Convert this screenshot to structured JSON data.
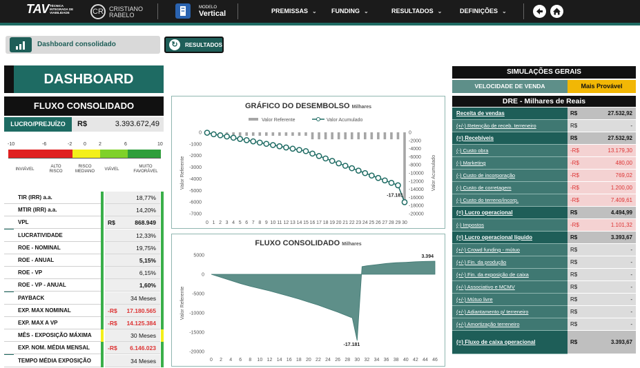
{
  "topbar": {
    "brand_tav": "TAV",
    "brand_tav_sub": "TÉCNICA INTEGRADA DE VIABILIDADE",
    "brand_cr_line1": "CRISTIANO",
    "brand_cr_line2": "RABELO",
    "modelo_label": "MODELO",
    "modelo_value": "Vertical",
    "menu": [
      "PREMISSAS",
      "FUNDING",
      "RESULTADOS",
      "DEFINIÇÕES"
    ],
    "icons": [
      "back-arrow-icon",
      "home-icon"
    ]
  },
  "breadcrumb": {
    "label": "Dashboard consolidado"
  },
  "resultados_button": "RESULTADOS",
  "dashboard_title": "DASHBOARD",
  "fluxo_title": "FLUXO CONSOLIDADO",
  "lucro": {
    "label": "LUCRO/PREJUÍZO",
    "currency": "R$",
    "value": "3.393.672,49"
  },
  "scale": {
    "numbers": [
      "-10",
      "-6",
      "-2",
      "0",
      "2",
      "6",
      "10"
    ],
    "labels": [
      "INVIÁVEL",
      "ALTO RISCO",
      "RISCO MEDIANO",
      "VIÁVEL",
      "MUITO FAVORÁVEL"
    ],
    "colors": [
      "#e02020",
      "#f3ef1a",
      "#7fd12a",
      "#2f9e3b"
    ]
  },
  "kpis": [
    {
      "label": "TIR (IRR) a.a.",
      "currency": "",
      "value": "18,77%",
      "bold": false,
      "red": false
    },
    {
      "label": "MTIR (IRR) a.a.",
      "currency": "",
      "value": "14,20%",
      "bold": false,
      "red": false
    },
    {
      "label": "VPL",
      "currency": "R$",
      "value": "868.949",
      "bold": true,
      "red": false
    },
    {
      "label": "LUCRATIVIDADE",
      "currency": "",
      "value": "12,33%",
      "bold": false,
      "red": false
    },
    {
      "label": "ROE - NOMINAL",
      "currency": "",
      "value": "19,75%",
      "bold": false,
      "red": false
    },
    {
      "label": "ROE - ANUAL",
      "currency": "",
      "value": "5,15%",
      "bold": true,
      "red": false
    },
    {
      "label": "ROE - VP",
      "currency": "",
      "value": "6,15%",
      "bold": false,
      "red": false
    },
    {
      "label": "ROE - VP - ANUAL",
      "currency": "",
      "value": "1,60%",
      "bold": true,
      "red": false
    },
    {
      "label": "PAYBACK",
      "currency": "",
      "value": "34 Meses",
      "bold": false,
      "red": false
    },
    {
      "label": "EXP. MAX NOMINAL",
      "currency": "-R$",
      "value": "17.180.565",
      "bold": true,
      "red": true
    },
    {
      "label": "EXP. MAX A VP",
      "currency": "-R$",
      "value": "14.125.384",
      "bold": true,
      "red": true
    },
    {
      "label": "MÊS - EXPOSIÇÃO MÁXIMA",
      "currency": "",
      "value": "30 Meses",
      "bold": false,
      "red": false
    },
    {
      "label": "EXP. NOM. MÉDIA MENSAL",
      "currency": "-R$",
      "value": "6.146.023",
      "bold": true,
      "red": true
    },
    {
      "label": "TEMPO MÉDIA EXPOSIÇÃO",
      "currency": "",
      "value": "34 Meses",
      "bold": false,
      "red": false
    }
  ],
  "chart_data": [
    {
      "type": "bar",
      "title": "GRÁFICO DO DESEMBOLSO",
      "subtitle": "Milhares",
      "legend": [
        "Valor Referente",
        "Valor Acumulado"
      ],
      "legend_position": "top",
      "ylabel": "Valor Referente",
      "y2label": "Valor Acumulado",
      "ylim": [
        -7000,
        0
      ],
      "y2lim": [
        -20000,
        0
      ],
      "yticks": [
        "-7000",
        "-6000",
        "-5000",
        "-4000",
        "-3000",
        "-2000",
        "-1000",
        "0"
      ],
      "y2ticks": [
        "-20000",
        "-18000",
        "-16000",
        "-14000",
        "-12000",
        "-10000",
        "-8000",
        "-6000",
        "-4000",
        "-2000",
        "0"
      ],
      "categories": [
        "0",
        "1",
        "2",
        "3",
        "4",
        "5",
        "6",
        "7",
        "8",
        "9",
        "10",
        "11",
        "12",
        "13",
        "14",
        "15",
        "16",
        "17",
        "18",
        "19",
        "20",
        "21",
        "22",
        "23",
        "24",
        "25",
        "26",
        "27",
        "28",
        "29",
        "30"
      ],
      "series": [
        {
          "name": "Valor Referente",
          "type": "bar",
          "color": "#a6a6a6",
          "values": [
            -100,
            -380,
            -250,
            -300,
            -300,
            -300,
            -300,
            -300,
            -300,
            -300,
            -300,
            -300,
            -300,
            -300,
            -300,
            -300,
            -600,
            -600,
            -600,
            -600,
            -600,
            -600,
            -600,
            -600,
            -600,
            -600,
            -600,
            -600,
            -600,
            -600,
            -6000
          ]
        },
        {
          "name": "Valor Acumulado",
          "type": "line",
          "color": "#1e6b63",
          "values": [
            -100,
            -480,
            -730,
            -1030,
            -1330,
            -1630,
            -1930,
            -2230,
            -2530,
            -2830,
            -3130,
            -3430,
            -3730,
            -4030,
            -4330,
            -4630,
            -5230,
            -5830,
            -6430,
            -7030,
            -7630,
            -8230,
            -8830,
            -9430,
            -10030,
            -10630,
            -11230,
            -11830,
            -12430,
            -13030,
            -17181
          ]
        }
      ],
      "annotations": [
        {
          "label": "-17.181",
          "x": "30"
        }
      ]
    },
    {
      "type": "area",
      "title": "FLUXO CONSOLIDADO",
      "subtitle": "Milhares",
      "ylabel": "Valor Referente",
      "ylim": [
        -20000,
        5000
      ],
      "yticks": [
        "-20000",
        "-15000",
        "-10000",
        "-5000",
        "0",
        "5000"
      ],
      "xticks": [
        "0",
        "2",
        "4",
        "6",
        "8",
        "10",
        "12",
        "14",
        "16",
        "18",
        "20",
        "22",
        "24",
        "26",
        "28",
        "30",
        "32",
        "34",
        "36",
        "38",
        "40",
        "42",
        "44",
        "46"
      ],
      "series": [
        {
          "name": "Fluxo",
          "color": "#5e8f89",
          "x": [
            0,
            2,
            4,
            6,
            8,
            10,
            12,
            14,
            16,
            18,
            20,
            22,
            24,
            26,
            28,
            29,
            30,
            31,
            32,
            34,
            36,
            38,
            40,
            42,
            44,
            46
          ],
          "values": [
            0,
            -800,
            -1600,
            -2400,
            -3100,
            -3700,
            -4300,
            -5000,
            -5700,
            -6400,
            -7200,
            -8000,
            -8900,
            -9800,
            -10800,
            -11300,
            -17181,
            2000,
            2200,
            2500,
            2800,
            3000,
            3100,
            3250,
            3350,
            3394
          ]
        }
      ],
      "annotations": [
        {
          "label": "3.394",
          "x": 46
        },
        {
          "label": "-17.181",
          "x": 30
        }
      ]
    }
  ],
  "simulacoes": {
    "title": "SIMULAÇÕES GERAIS",
    "vv_label": "VELOCIDADE DE VENDA",
    "vv_value": "Mais Provável"
  },
  "dre": {
    "title": "DRE - Milhares de Reais",
    "rows": [
      {
        "label": "Receita de vendas",
        "currency": "R$",
        "value": "27.532,92",
        "style": "hd"
      },
      {
        "label": "(+/-) Retenção de receb. terreneiro",
        "currency": "R$",
        "value": "-",
        "style": ""
      },
      {
        "label": "(=) Recebíveis",
        "currency": "R$",
        "value": "27.532,92",
        "style": "hd"
      },
      {
        "label": "(-) Custo obra",
        "currency": "-R$",
        "value": "13.179,30",
        "style": "neg"
      },
      {
        "label": "(-) Marketing",
        "currency": "-R$",
        "value": "480,00",
        "style": "neg"
      },
      {
        "label": "(-) Custo de incorporação",
        "currency": "-R$",
        "value": "769,02",
        "style": "neg"
      },
      {
        "label": "(-) Custo de corretagem",
        "currency": "-R$",
        "value": "1.200,00",
        "style": "neg"
      },
      {
        "label": "(-) Custo do terreno/incorp.",
        "currency": "-R$",
        "value": "7.409,61",
        "style": "neg"
      },
      {
        "label": "(=) Lucro operacional",
        "currency": "R$",
        "value": "4.494,99",
        "style": "hd"
      },
      {
        "label": "(-) Impostos",
        "currency": "-R$",
        "value": "1.101,32",
        "style": "neg"
      },
      {
        "label": "(=) Lucro operacional líquido",
        "currency": "R$",
        "value": "3.393,67",
        "style": "hd"
      },
      {
        "label": "(+/-) Crowd funding - mútuo",
        "currency": "R$",
        "value": "-",
        "style": ""
      },
      {
        "label": "(+/-) Fin. da produção",
        "currency": "R$",
        "value": "-",
        "style": ""
      },
      {
        "label": "(+/-) Fin. da exposição de caixa",
        "currency": "R$",
        "value": "-",
        "style": ""
      },
      {
        "label": "(+/-) Associativo e MCMV",
        "currency": "R$",
        "value": "-",
        "style": ""
      },
      {
        "label": "(+/-) Mútuo livre",
        "currency": "R$",
        "value": "-",
        "style": ""
      },
      {
        "label": "(+/-) Adiantamento p/ terreneiro",
        "currency": "R$",
        "value": "-",
        "style": ""
      },
      {
        "label": "(+/-) Amortização terreneiro",
        "currency": "R$",
        "value": "-",
        "style": ""
      },
      {
        "label": "(=) Fluxo de caixa operacional",
        "currency": "R$",
        "value": "3.393,67",
        "style": "hd"
      }
    ]
  }
}
